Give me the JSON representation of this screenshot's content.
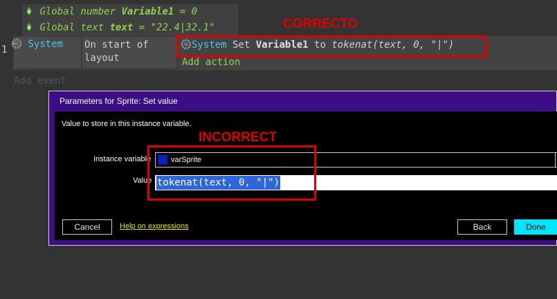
{
  "events": {
    "global_number": {
      "keyword": "Global number",
      "name": "Variable1",
      "rest": " = 0"
    },
    "global_text": {
      "keyword": "Global text",
      "name": "text",
      "rest": " = \"22.4|32.1\""
    },
    "event_number": "1",
    "condition": {
      "object": "System",
      "text_line1": "On start of",
      "text_line2": "layout"
    },
    "action": {
      "object": "System",
      "verb": "Set",
      "var": "Variable1",
      "prep": "to",
      "expr": "tokenat(text, 0, \"|\")"
    },
    "add_action": "Add action",
    "add_event": "Add event"
  },
  "annotations": {
    "correct": "CORRECTO",
    "incorrect": "INCORRECT"
  },
  "dialog": {
    "title": "Parameters for Sprite: Set value",
    "description": "Value to store in this instance variable.",
    "instance_label": "Instance variable",
    "instance_value": "varSprite",
    "value_label": "Value",
    "value_text": "tokenat(text, 0, \"|\")",
    "cancel": "Cancel",
    "help": "Help on expressions",
    "back": "Back",
    "done": "Done"
  },
  "colors": {
    "green": "#8fd14f",
    "cyan": "#4fc3e8",
    "red": "#e00000",
    "purple": "#3b0e85",
    "done_bg": "#00e5ff"
  }
}
